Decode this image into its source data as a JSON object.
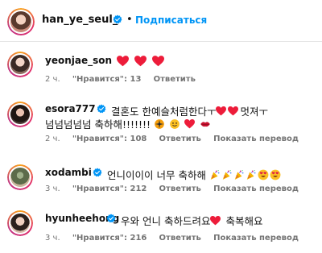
{
  "header": {
    "username": "han_ye_seul_",
    "separator": "•",
    "follow_label": "Подписаться"
  },
  "comments": [
    {
      "username": "yeonjae_son",
      "verified": false,
      "text": "",
      "emoji": [
        "red-heart",
        "red-heart",
        "red-heart"
      ],
      "time": "2 ч.",
      "likes": "\"Нравится\": 13",
      "reply": "Ответить"
    },
    {
      "username": "esora777",
      "verified": true,
      "text": "결혼도 한예슬처럼한다ㅜ",
      "text_after_hearts": "멋져ㅜ",
      "text_line2": "넘넘넘넘넘 축하해!!!!!!!",
      "time": "2 ч.",
      "likes": "\"Нравится\": 108",
      "reply": "Ответить",
      "translate": "Показать перевод"
    },
    {
      "username": "xodambi",
      "verified": true,
      "text": "언니이이이 너무 축하해",
      "time": "3 ч.",
      "likes": "\"Нравится\": 212",
      "reply": "Ответить",
      "translate": "Показать перевод"
    },
    {
      "username": "hyunheehong",
      "verified": true,
      "text": "우와 언니 축하드려요",
      "text_after_heart": "축복해요",
      "time": "3 ч.",
      "likes": "\"Нравится\": 216",
      "reply": "Ответить",
      "translate": "Показать перевод"
    }
  ],
  "colors": {
    "accent": "#0095f6",
    "verified": "#0095f6",
    "heart": "#ed1c3a",
    "meta": "#737373"
  }
}
